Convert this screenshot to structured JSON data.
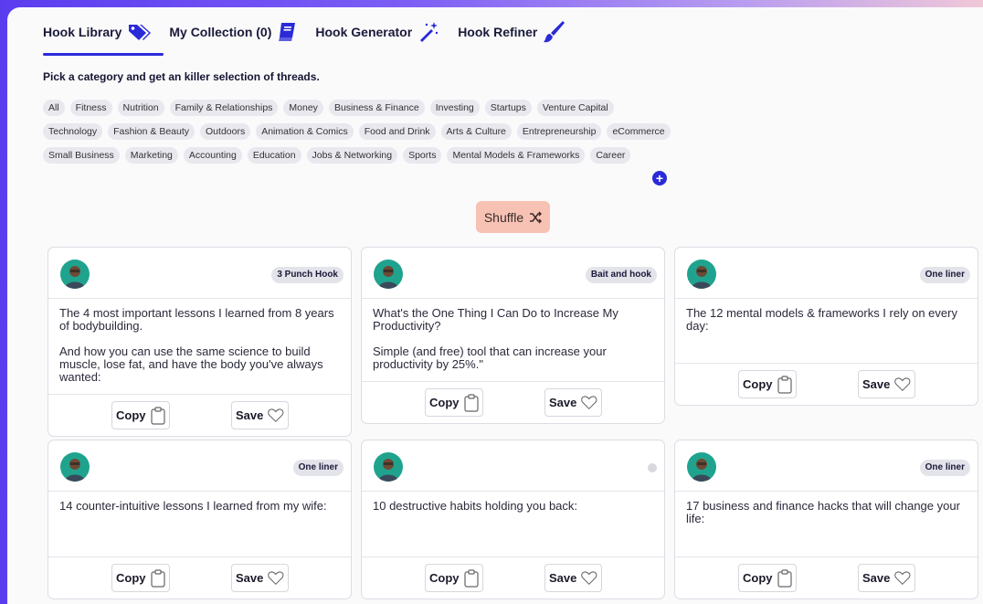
{
  "tabs": [
    {
      "label": "Hook Library",
      "icon": "tags-icon"
    },
    {
      "label": "My Collection (0)",
      "icon": "book-icon"
    },
    {
      "label": "Hook Generator",
      "icon": "magic-wand-icon"
    },
    {
      "label": "Hook Refiner",
      "icon": "paintbrush-icon"
    }
  ],
  "subtitle": "Pick a category and get an killer selection of threads.",
  "categories": [
    [
      "All",
      "Fitness",
      "Nutrition",
      "Family & Relationships",
      "Money",
      "Business & Finance",
      "Investing",
      "Startups",
      "Venture Capital"
    ],
    [
      "Technology",
      "Fashion & Beauty",
      "Outdoors",
      "Animation & Comics",
      "Food and Drink",
      "Arts & Culture",
      "Entrepreneurship",
      "eCommerce"
    ],
    [
      "Small Business",
      "Marketing",
      "Accounting",
      "Education",
      "Jobs & Networking",
      "Sports",
      "Mental Models & Frameworks",
      "Career"
    ]
  ],
  "add_icon": "+",
  "shuffle_label": "Shuffle",
  "cards": [
    {
      "badge": "3 Punch Hook",
      "p1": "The 4 most important lessons I learned from 8 years of bodybuilding.",
      "p2": "And how you can use the same science to build muscle, lose fat, and have the body you've always wanted:"
    },
    {
      "badge": "Bait and hook",
      "p1": "What's the One Thing I Can Do to Increase My Productivity?",
      "p2": "Simple (and free) tool that can increase your productivity by 25%.\""
    },
    {
      "badge": "One liner",
      "p1": "The 12 mental models & frameworks I rely on every day:",
      "p2": ""
    },
    {
      "badge": "One liner",
      "p1": "14 counter-intuitive lessons I learned from my wife:",
      "p2": ""
    },
    {
      "badge": "",
      "p1": "10 destructive habits holding you back:",
      "p2": ""
    },
    {
      "badge": "One liner",
      "p1": "17 business and finance hacks that will change your life:",
      "p2": ""
    }
  ],
  "copy_label": "Copy",
  "save_label": "Save",
  "colors": {
    "accent": "#2a2ad8",
    "shuffle_bg": "#f7c2b4",
    "avatar_bg": "#20a38e"
  }
}
